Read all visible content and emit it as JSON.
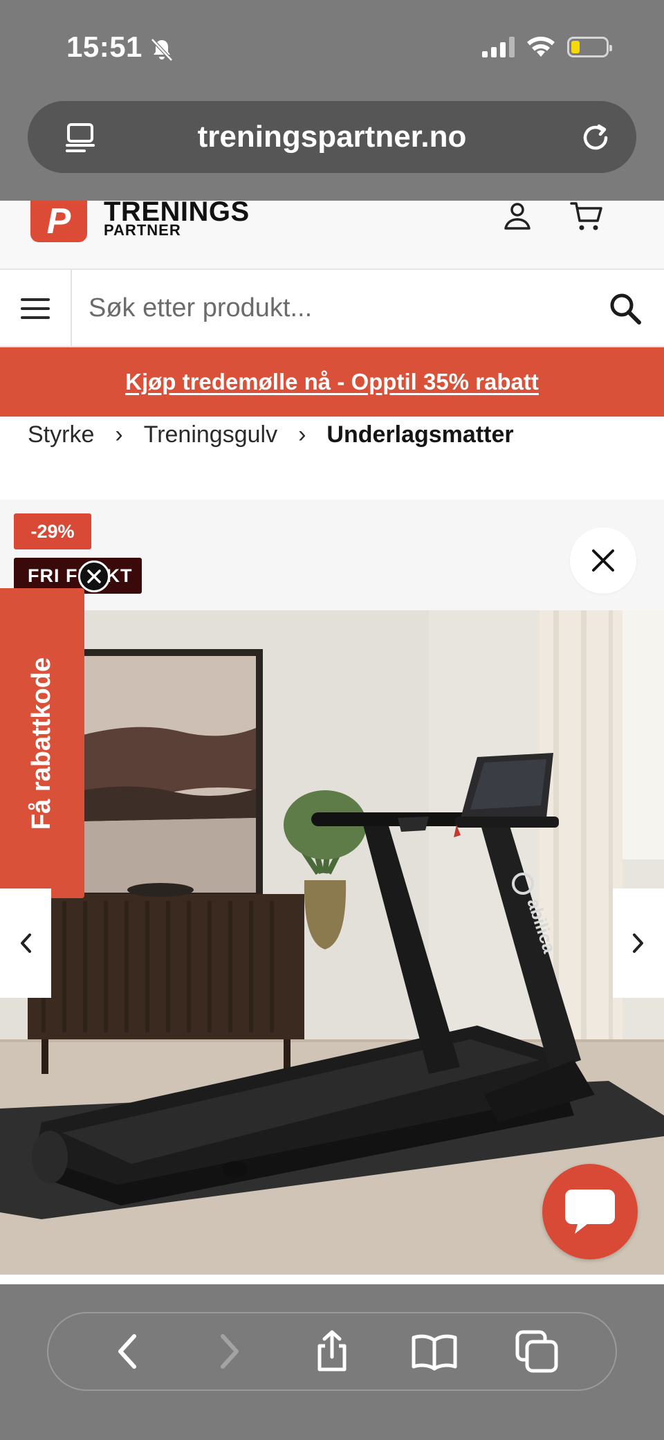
{
  "status_bar": {
    "time": "15:51"
  },
  "browser": {
    "url": "treningspartner.no"
  },
  "site": {
    "logo_mark": "P",
    "logo_title": "TRENINGS",
    "logo_subtitle": "PARTNER"
  },
  "search": {
    "placeholder": "Søk etter produkt..."
  },
  "promo": {
    "text": "Kjøp tredemølle nå - Opptil 35% rabatt"
  },
  "breadcrumb": {
    "items": [
      "Styrke",
      "Treningsgulv",
      "Underlagsmatter"
    ],
    "separator": "›"
  },
  "product": {
    "discount_badge": "-29%",
    "shipping_badge": "FRI FRAKT",
    "brand_on_image": "abilica"
  },
  "side_tab": {
    "label": "Få rabattkode"
  },
  "colors": {
    "brand_red": "#d95139",
    "chrome_gray": "#7b7b7b",
    "badge_dark": "#3a0a0a"
  }
}
